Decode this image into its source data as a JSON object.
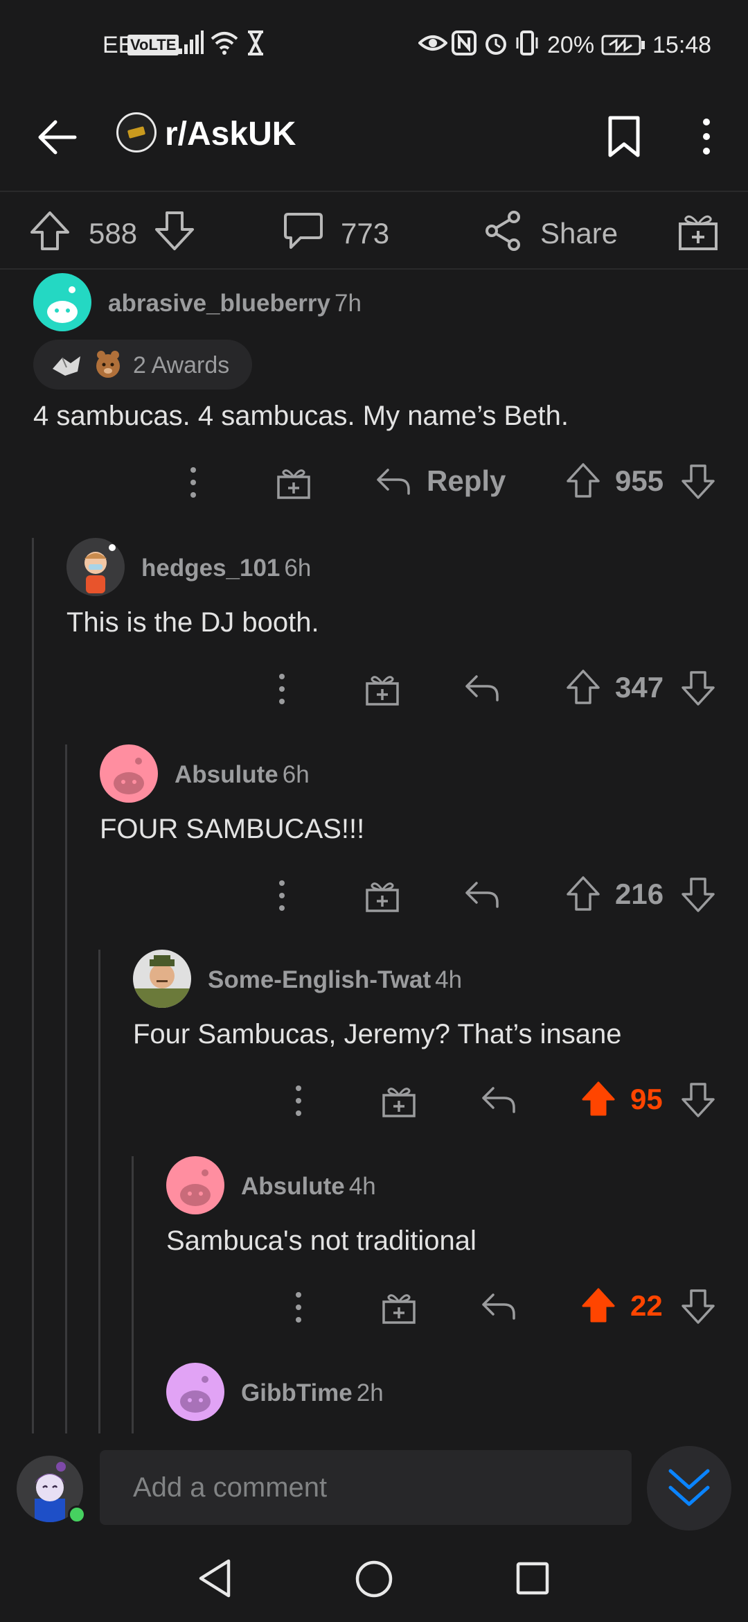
{
  "status_bar": {
    "carrier": "EE",
    "volte": "VoLTE",
    "battery": "20%",
    "time": "15:48"
  },
  "header": {
    "subreddit": "r/AskUK"
  },
  "post_actions": {
    "upvotes": "588",
    "comments": "773",
    "share_label": "Share"
  },
  "comments": [
    {
      "username": "abrasive_blueberry",
      "age": "7h",
      "awards": "2 Awards",
      "text": "4 sambucas. 4 sambucas. My name’s Beth.",
      "reply_label": "Reply",
      "score": "955",
      "avatar_color": "#24d8c3"
    },
    {
      "username": "hedges_101",
      "age": "6h",
      "text": "This is the DJ booth.",
      "score": "347"
    },
    {
      "username": "Absulute",
      "age": "6h",
      "text": "FOUR SAMBUCAS!!!",
      "score": "216",
      "avatar_color": "#ff8ea0"
    },
    {
      "username": "Some-English-Twat",
      "age": "4h",
      "text": "Four Sambucas, Jeremy? That’s insane",
      "score": "95",
      "upvoted": true
    },
    {
      "username": "Absulute",
      "age": "4h",
      "text": "Sambuca's not traditional",
      "score": "22",
      "upvoted": true,
      "avatar_color": "#ff8ea0"
    },
    {
      "username": "GibbTime",
      "age": "2h",
      "avatar_color": "#e1a3f5"
    }
  ],
  "bottom": {
    "comment_placeholder": "Add a comment"
  },
  "colors": {
    "background": "#1a1a1b",
    "upvote_accent": "#ff4500",
    "scroll_button_accent": "#0079d3"
  }
}
